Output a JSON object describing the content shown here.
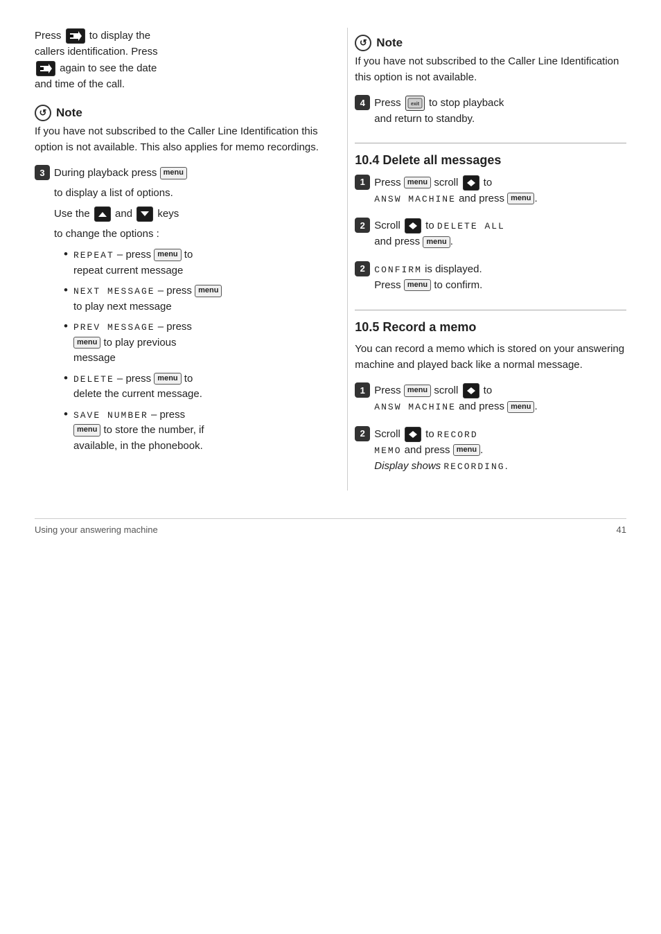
{
  "page": {
    "footer": {
      "left": "Using your answering machine",
      "right": "41"
    }
  },
  "left": {
    "intro": {
      "line1": "Press",
      "line2": "to display the",
      "line3": "callers identification. Press",
      "line4": "again to see the date",
      "line5": "and time of the call."
    },
    "note1": {
      "title": "Note",
      "text": "If you have not subscribed to the Caller Line Identification this option is not available. This also applies for memo recordings."
    },
    "step3": {
      "number": "3",
      "line1": "During playback press",
      "line2": "to display a list of options.",
      "line3": "Use the",
      "line4": "and",
      "line5": "keys",
      "line6": "to change the options :"
    },
    "bullets": [
      {
        "code": "REPEAT",
        "desc": "– press",
        "desc2": "to",
        "desc3": "repeat current message"
      },
      {
        "code": "NEXT MESSAGE",
        "desc": "– press",
        "desc2": "to play next message"
      },
      {
        "code": "PREV MESSAGE",
        "desc": "– press",
        "desc2": "to play previous message"
      },
      {
        "code": "DELETE",
        "desc": "– press",
        "desc2": "to",
        "desc3": "delete the current message."
      },
      {
        "code": "SAVE NUMBER",
        "desc": "– press",
        "desc2": "to store the number, if available, in the phonebook."
      }
    ]
  },
  "right": {
    "note2": {
      "title": "Note",
      "text": "If you have not subscribed to the Caller Line Identification this option is not available."
    },
    "step4": {
      "number": "4",
      "line1": "Press",
      "line2": "to stop playback",
      "line3": "and return to standby."
    },
    "section_delete": {
      "title": "10.4  Delete all messages",
      "step1": {
        "number": "1",
        "line1": "Press",
        "line2": "scroll",
        "line3": "to",
        "code": "ANSW MACHINE",
        "line4": "and press",
        "menu": "menu"
      },
      "step2a": {
        "number": "2",
        "line1": "Scroll",
        "line2": "to",
        "code": "DELETE ALL",
        "line3": "and press",
        "menu": "menu"
      },
      "step2b": {
        "number": "2",
        "code": "CONFIRM",
        "line1": "is displayed.",
        "line2": "Press",
        "line3": "to confirm.",
        "menu": "menu"
      }
    },
    "section_memo": {
      "title": "10.5  Record a memo",
      "intro": "You can record a memo which is stored on your answering machine and played back like a normal message.",
      "step1": {
        "number": "1",
        "line1": "Press",
        "line2": "scroll",
        "line3": "to",
        "code": "ANSW MACHINE",
        "line4": "and press",
        "menu": "menu"
      },
      "step2": {
        "number": "2",
        "line1": "Scroll",
        "line2": "to",
        "code1": "RECORD",
        "code2": "MEMO",
        "line3": "and press",
        "menu": "menu",
        "line4": "Display shows",
        "code3": "RECORDING"
      }
    }
  }
}
